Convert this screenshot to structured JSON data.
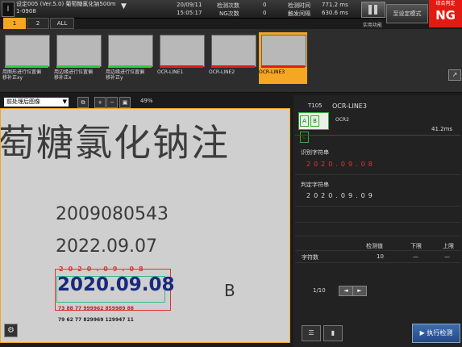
{
  "header": {
    "setting_title_line1": "设定005 (Ver.5.0) 葡萄糖氯化钠500m",
    "setting_title_line2": "1-0908",
    "date": "20/09/11",
    "time": "15:05:17",
    "insp_count_label": "检测次数",
    "insp_count_value": "0",
    "ng_count_label": "NG次数",
    "ng_count_value": "0",
    "insp_time_label": "检测时间",
    "insp_time_value": "771.2 ms",
    "trigger_interval_label": "触发间隔",
    "trigger_interval_value": "630.6 ms",
    "tool_label": "实用功能",
    "mode_button_label": "至设定模式",
    "judge_label": "综合判定",
    "judge_value": "NG"
  },
  "tabs": [
    {
      "label": "1"
    },
    {
      "label": "2"
    },
    {
      "label": "ALL"
    }
  ],
  "thumbnails": [
    {
      "label_line1": "用图形进行位置偏",
      "label_line2": "移补正xy",
      "bar": "#2ecc40"
    },
    {
      "label_line1": "用边缘进行位置偏",
      "label_line2": "移补正x",
      "bar": "#2ecc40"
    },
    {
      "label_line1": "用边缘进行位置偏",
      "label_line2": "移补正y",
      "bar": "#2ecc40"
    },
    {
      "label_line1": "OCR-LINE1",
      "label_line2": "",
      "bar": "#e21b12"
    },
    {
      "label_line1": "OCR-LINE2",
      "label_line2": "",
      "bar": "#e21b12"
    },
    {
      "label_line1": "OCR-LINE3",
      "label_line2": "",
      "bar": "#e21b12"
    }
  ],
  "image_toolbar": {
    "select_value": "前处理后图像",
    "zoom_value": "49%"
  },
  "image": {
    "big_text": "萄糖氯化钠注",
    "line1": "2009080543",
    "line2": "2022.09.07",
    "line3": "2020.09.08",
    "b_mark": "B",
    "roi_chars": "2020.09.08",
    "roi_digits_red": "73 88 77 999962 859989 88",
    "roi_digits_black": "79 62 77 829969 129947 11"
  },
  "result_panel": {
    "tool_id": "T105",
    "tool_name": "OCR-LINE3",
    "sub_name": "OCR2",
    "time": "41.2ms",
    "recognized_label": "识别字符串",
    "recognized_value": "2020.09.08",
    "judge_string_label": "判定字符串",
    "judge_string_value": "2020.09.09",
    "col_detect": "检测值",
    "col_lower": "下限",
    "col_upper": "上限",
    "row_label": "字符数",
    "row_detect": "10",
    "row_lower": "—",
    "row_upper": "—",
    "page": "1/10",
    "run_label": "执行检测"
  }
}
